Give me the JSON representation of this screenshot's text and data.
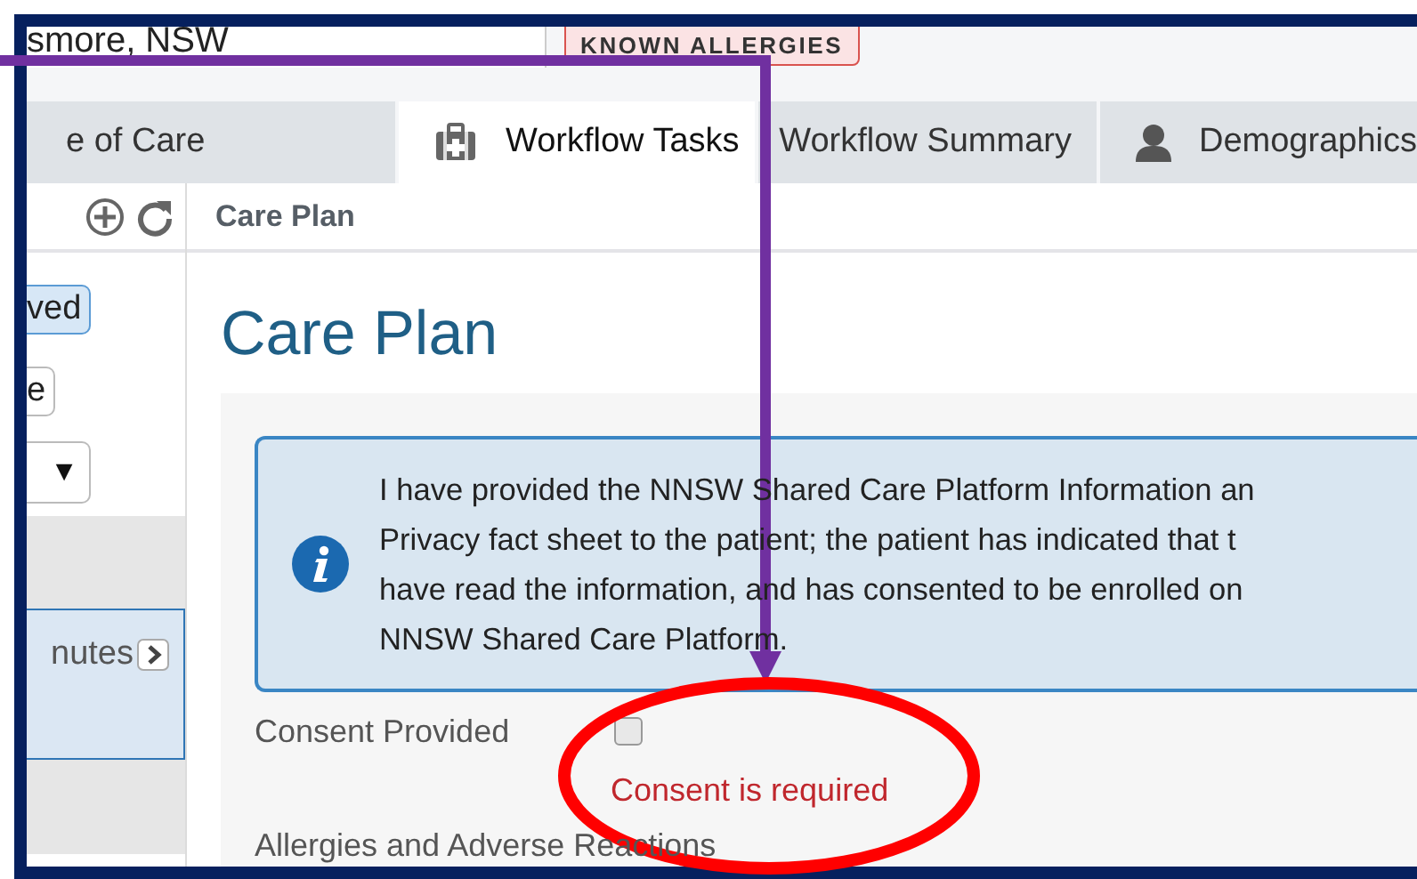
{
  "header": {
    "location": "smore, NSW",
    "badge": "KNOWN ALLERGIES"
  },
  "tabs": [
    {
      "label": "e of Care",
      "kind": "plain",
      "selected": false
    },
    {
      "label": "Workflow Tasks",
      "kind": "medkit",
      "selected": true
    },
    {
      "label": "Workflow Summary",
      "kind": "plain",
      "selected": false
    },
    {
      "label": "Demographics",
      "kind": "person",
      "selected": false
    }
  ],
  "sidebar": {
    "filters": [
      {
        "label": "ved",
        "selected": true
      },
      {
        "label": "e",
        "selected": false
      }
    ],
    "dropdown": {
      "caret": "▼"
    },
    "items": [
      {
        "label": "nutes",
        "selected": true
      }
    ]
  },
  "panel_header": "Care Plan",
  "form": {
    "title": "Care Plan",
    "info": "I have provided the NNSW Shared Care Platform Information an\nPrivacy fact sheet to the patient; the patient has indicated that t\nhave read the information, and has consented to be enrolled on\nNNSW Shared Care Platform.",
    "consent": {
      "label": "Consent Provided",
      "checked": false,
      "error": "Consent is required"
    },
    "next_section": "Allergies and Adverse Reactions"
  },
  "annotations": [
    {
      "kind": "arrow",
      "color": "#7030a0"
    },
    {
      "kind": "ellipse",
      "color": "#ff0000"
    }
  ]
}
